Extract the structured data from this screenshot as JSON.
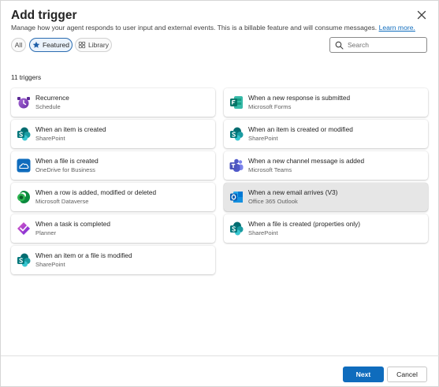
{
  "dialog": {
    "title": "Add trigger",
    "description": "Manage how your agent responds to user input and external events. This is a billable feature and will consume messages. ",
    "learn_more": "Learn more."
  },
  "filters": {
    "all": "All",
    "featured": "Featured",
    "library": "Library",
    "selected": "Featured"
  },
  "search": {
    "placeholder": "Search",
    "value": ""
  },
  "count_label": "11 triggers",
  "triggers": [
    {
      "name": "Recurrence",
      "source": "Schedule",
      "icon": "schedule-icon"
    },
    {
      "name": "When a new response is submitted",
      "source": "Microsoft Forms",
      "icon": "forms-icon"
    },
    {
      "name": "When an item is created",
      "source": "SharePoint",
      "icon": "sharepoint-icon"
    },
    {
      "name": "When an item is created or modified",
      "source": "SharePoint",
      "icon": "sharepoint-icon"
    },
    {
      "name": "When a file is created",
      "source": "OneDrive for Business",
      "icon": "onedrive-icon"
    },
    {
      "name": "When a new channel message is added",
      "source": "Microsoft Teams",
      "icon": "teams-icon"
    },
    {
      "name": "When a row is added, modified or deleted",
      "source": "Microsoft Dataverse",
      "icon": "dataverse-icon"
    },
    {
      "name": "When a new email arrives (V3)",
      "source": "Office 365 Outlook",
      "icon": "outlook-icon",
      "selected": true
    },
    {
      "name": "When a task is completed",
      "source": "Planner",
      "icon": "planner-icon"
    },
    {
      "name": "When a file is created (properties only)",
      "source": "SharePoint",
      "icon": "sharepoint-icon"
    },
    {
      "name": "When an item or a file is modified",
      "source": "SharePoint",
      "icon": "sharepoint-icon"
    }
  ],
  "footer": {
    "next": "Next",
    "cancel": "Cancel"
  },
  "colors": {
    "accent": "#0f6cbd",
    "selected_card": "#e6e6e6",
    "featured_pill_border": "#2b6cb0"
  }
}
